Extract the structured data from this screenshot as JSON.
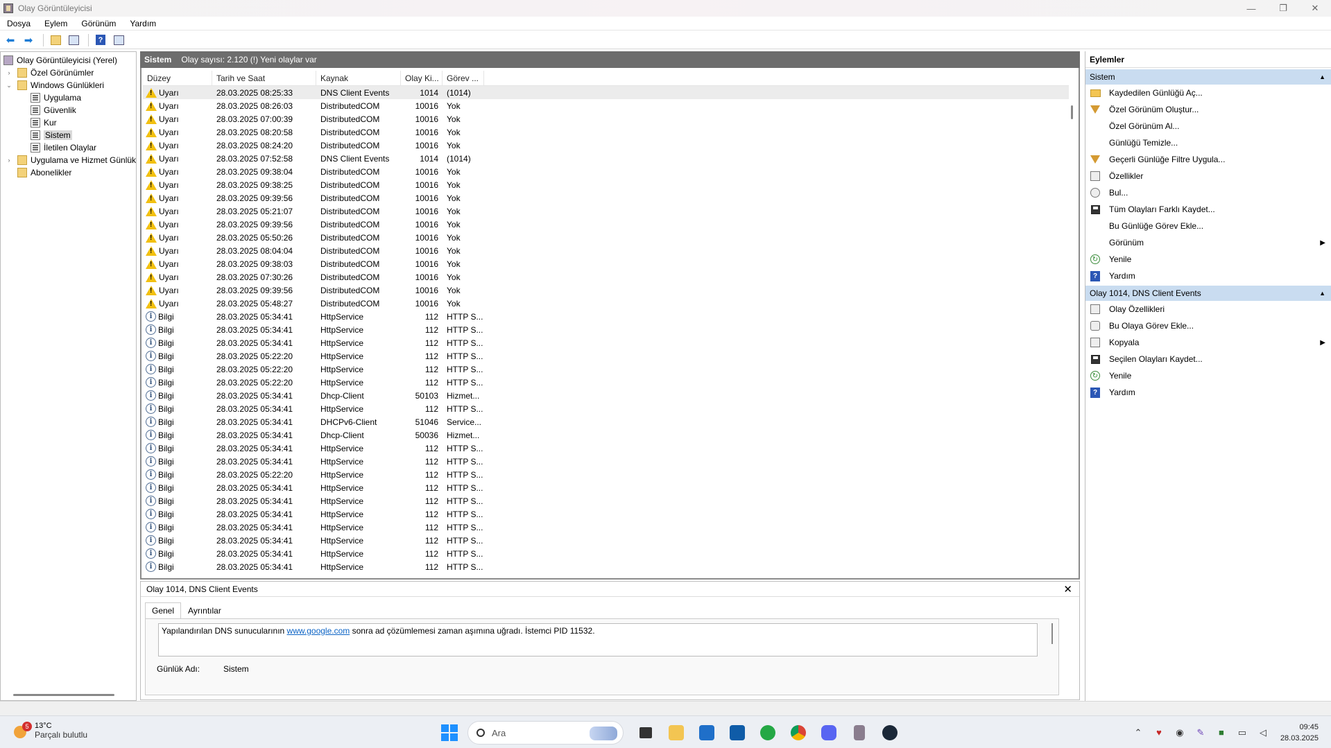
{
  "window": {
    "title": "Olay Görüntüleyicisi",
    "controls": [
      "—",
      "❐",
      "✕"
    ]
  },
  "menu": [
    "Dosya",
    "Eylem",
    "Görünüm",
    "Yardım"
  ],
  "tree": [
    {
      "label": "Olay Görüntüleyicisi (Yerel)",
      "level": 0,
      "expander": "",
      "icon": "event-viewer-icon"
    },
    {
      "label": "Özel Görünümler",
      "level": 1,
      "expander": "›",
      "icon": "folder-icon"
    },
    {
      "label": "Windows Günlükleri",
      "level": 1,
      "expander": "⌄",
      "icon": "folder-icon"
    },
    {
      "label": "Uygulama",
      "level": 2,
      "expander": "",
      "icon": "log-icon"
    },
    {
      "label": "Güvenlik",
      "level": 2,
      "expander": "",
      "icon": "log-icon"
    },
    {
      "label": "Kur",
      "level": 2,
      "expander": "",
      "icon": "log-icon"
    },
    {
      "label": "Sistem",
      "level": 2,
      "expander": "",
      "icon": "log-icon",
      "selected": true
    },
    {
      "label": "İletilen Olaylar",
      "level": 2,
      "expander": "",
      "icon": "log-icon"
    },
    {
      "label": "Uygulama ve Hizmet Günlük",
      "level": 1,
      "expander": "›",
      "icon": "folder-icon"
    },
    {
      "label": "Abonelikler",
      "level": 1,
      "expander": "",
      "icon": "subscriptions-icon"
    }
  ],
  "center": {
    "log_name": "Sistem",
    "event_count_text": "Olay sayısı: 2.120 (!) Yeni olaylar var",
    "columns": [
      "Düzey",
      "Tarih ve Saat",
      "Kaynak",
      "Olay Ki...",
      "Görev ..."
    ],
    "rows": [
      {
        "level": "Uyarı",
        "type": "warning",
        "date": "28.03.2025 08:25:33",
        "source": "DNS Client Events",
        "id": "1014",
        "task": "(1014)"
      },
      {
        "level": "Uyarı",
        "type": "warning",
        "date": "28.03.2025 08:26:03",
        "source": "DistributedCOM",
        "id": "10016",
        "task": "Yok"
      },
      {
        "level": "Uyarı",
        "type": "warning",
        "date": "28.03.2025 07:00:39",
        "source": "DistributedCOM",
        "id": "10016",
        "task": "Yok"
      },
      {
        "level": "Uyarı",
        "type": "warning",
        "date": "28.03.2025 08:20:58",
        "source": "DistributedCOM",
        "id": "10016",
        "task": "Yok"
      },
      {
        "level": "Uyarı",
        "type": "warning",
        "date": "28.03.2025 08:24:20",
        "source": "DistributedCOM",
        "id": "10016",
        "task": "Yok"
      },
      {
        "level": "Uyarı",
        "type": "warning",
        "date": "28.03.2025 07:52:58",
        "source": "DNS Client Events",
        "id": "1014",
        "task": "(1014)"
      },
      {
        "level": "Uyarı",
        "type": "warning",
        "date": "28.03.2025 09:38:04",
        "source": "DistributedCOM",
        "id": "10016",
        "task": "Yok"
      },
      {
        "level": "Uyarı",
        "type": "warning",
        "date": "28.03.2025 09:38:25",
        "source": "DistributedCOM",
        "id": "10016",
        "task": "Yok"
      },
      {
        "level": "Uyarı",
        "type": "warning",
        "date": "28.03.2025 09:39:56",
        "source": "DistributedCOM",
        "id": "10016",
        "task": "Yok"
      },
      {
        "level": "Uyarı",
        "type": "warning",
        "date": "28.03.2025 05:21:07",
        "source": "DistributedCOM",
        "id": "10016",
        "task": "Yok"
      },
      {
        "level": "Uyarı",
        "type": "warning",
        "date": "28.03.2025 09:39:56",
        "source": "DistributedCOM",
        "id": "10016",
        "task": "Yok"
      },
      {
        "level": "Uyarı",
        "type": "warning",
        "date": "28.03.2025 05:50:26",
        "source": "DistributedCOM",
        "id": "10016",
        "task": "Yok"
      },
      {
        "level": "Uyarı",
        "type": "warning",
        "date": "28.03.2025 08:04:04",
        "source": "DistributedCOM",
        "id": "10016",
        "task": "Yok"
      },
      {
        "level": "Uyarı",
        "type": "warning",
        "date": "28.03.2025 09:38:03",
        "source": "DistributedCOM",
        "id": "10016",
        "task": "Yok"
      },
      {
        "level": "Uyarı",
        "type": "warning",
        "date": "28.03.2025 07:30:26",
        "source": "DistributedCOM",
        "id": "10016",
        "task": "Yok"
      },
      {
        "level": "Uyarı",
        "type": "warning",
        "date": "28.03.2025 09:39:56",
        "source": "DistributedCOM",
        "id": "10016",
        "task": "Yok"
      },
      {
        "level": "Uyarı",
        "type": "warning",
        "date": "28.03.2025 05:48:27",
        "source": "DistributedCOM",
        "id": "10016",
        "task": "Yok"
      },
      {
        "level": "Bilgi",
        "type": "info",
        "date": "28.03.2025 05:34:41",
        "source": "HttpService",
        "id": "112",
        "task": "HTTP S..."
      },
      {
        "level": "Bilgi",
        "type": "info",
        "date": "28.03.2025 05:34:41",
        "source": "HttpService",
        "id": "112",
        "task": "HTTP S..."
      },
      {
        "level": "Bilgi",
        "type": "info",
        "date": "28.03.2025 05:34:41",
        "source": "HttpService",
        "id": "112",
        "task": "HTTP S..."
      },
      {
        "level": "Bilgi",
        "type": "info",
        "date": "28.03.2025 05:22:20",
        "source": "HttpService",
        "id": "112",
        "task": "HTTP S..."
      },
      {
        "level": "Bilgi",
        "type": "info",
        "date": "28.03.2025 05:22:20",
        "source": "HttpService",
        "id": "112",
        "task": "HTTP S..."
      },
      {
        "level": "Bilgi",
        "type": "info",
        "date": "28.03.2025 05:22:20",
        "source": "HttpService",
        "id": "112",
        "task": "HTTP S..."
      },
      {
        "level": "Bilgi",
        "type": "info",
        "date": "28.03.2025 05:34:41",
        "source": "Dhcp-Client",
        "id": "50103",
        "task": "Hizmet..."
      },
      {
        "level": "Bilgi",
        "type": "info",
        "date": "28.03.2025 05:34:41",
        "source": "HttpService",
        "id": "112",
        "task": "HTTP S..."
      },
      {
        "level": "Bilgi",
        "type": "info",
        "date": "28.03.2025 05:34:41",
        "source": "DHCPv6-Client",
        "id": "51046",
        "task": "Service..."
      },
      {
        "level": "Bilgi",
        "type": "info",
        "date": "28.03.2025 05:34:41",
        "source": "Dhcp-Client",
        "id": "50036",
        "task": "Hizmet..."
      },
      {
        "level": "Bilgi",
        "type": "info",
        "date": "28.03.2025 05:34:41",
        "source": "HttpService",
        "id": "112",
        "task": "HTTP S..."
      },
      {
        "level": "Bilgi",
        "type": "info",
        "date": "28.03.2025 05:34:41",
        "source": "HttpService",
        "id": "112",
        "task": "HTTP S..."
      },
      {
        "level": "Bilgi",
        "type": "info",
        "date": "28.03.2025 05:22:20",
        "source": "HttpService",
        "id": "112",
        "task": "HTTP S..."
      },
      {
        "level": "Bilgi",
        "type": "info",
        "date": "28.03.2025 05:34:41",
        "source": "HttpService",
        "id": "112",
        "task": "HTTP S..."
      },
      {
        "level": "Bilgi",
        "type": "info",
        "date": "28.03.2025 05:34:41",
        "source": "HttpService",
        "id": "112",
        "task": "HTTP S..."
      },
      {
        "level": "Bilgi",
        "type": "info",
        "date": "28.03.2025 05:34:41",
        "source": "HttpService",
        "id": "112",
        "task": "HTTP S..."
      },
      {
        "level": "Bilgi",
        "type": "info",
        "date": "28.03.2025 05:34:41",
        "source": "HttpService",
        "id": "112",
        "task": "HTTP S..."
      },
      {
        "level": "Bilgi",
        "type": "info",
        "date": "28.03.2025 05:34:41",
        "source": "HttpService",
        "id": "112",
        "task": "HTTP S..."
      },
      {
        "level": "Bilgi",
        "type": "info",
        "date": "28.03.2025 05:34:41",
        "source": "HttpService",
        "id": "112",
        "task": "HTTP S..."
      },
      {
        "level": "Bilgi",
        "type": "info",
        "date": "28.03.2025 05:34:41",
        "source": "HttpService",
        "id": "112",
        "task": "HTTP S..."
      }
    ]
  },
  "detail": {
    "title": "Olay 1014, DNS Client Events",
    "close": "✕",
    "tabs": [
      "Genel",
      "Ayrıntılar"
    ],
    "message_before": "Yapılandırılan DNS sunucularının ",
    "message_link": "www.google.com",
    "message_after": " sonra ad çözümlemesi zaman aşımına uğradı. İstemci PID 11532.",
    "log_name_label": "Günlük Adı:",
    "log_name_value": "Sistem"
  },
  "actions": {
    "title": "Eylemler",
    "sections": [
      {
        "name": "Sistem",
        "items": [
          {
            "label": "Kaydedilen Günlüğü Aç...",
            "icon": "open-log-icon"
          },
          {
            "label": "Özel Görünüm Oluştur...",
            "icon": "filter-icon"
          },
          {
            "label": "Özel Görünüm Al...",
            "icon": ""
          },
          {
            "label": "Günlüğü Temizle...",
            "icon": ""
          },
          {
            "label": "Geçerli Günlüğe Filtre Uygula...",
            "icon": "filter-icon"
          },
          {
            "label": "Özellikler",
            "icon": "properties-icon"
          },
          {
            "label": "Bul...",
            "icon": "find-icon"
          },
          {
            "label": "Tüm Olayları Farklı Kaydet...",
            "icon": "save-icon"
          },
          {
            "label": "Bu Günlüğe Görev Ekle...",
            "icon": ""
          },
          {
            "label": "Görünüm",
            "icon": "",
            "submenu": true
          },
          {
            "label": "Yenile",
            "icon": "refresh-icon"
          },
          {
            "label": "Yardım",
            "icon": "help-icon"
          }
        ]
      },
      {
        "name": "Olay 1014, DNS Client Events",
        "items": [
          {
            "label": "Olay Özellikleri",
            "icon": "properties-icon"
          },
          {
            "label": "Bu Olaya Görev Ekle...",
            "icon": "task-icon"
          },
          {
            "label": "Kopyala",
            "icon": "copy-icon",
            "submenu": true
          },
          {
            "label": "Seçilen Olayları Kaydet...",
            "icon": "save-icon"
          },
          {
            "label": "Yenile",
            "icon": "refresh-icon"
          },
          {
            "label": "Yardım",
            "icon": "help-icon"
          }
        ]
      }
    ]
  },
  "taskbar": {
    "weather_temp": "13°C",
    "weather_desc": "Parçalı bulutlu",
    "weather_badge": "5",
    "search_placeholder": "Ara",
    "time": "09:45",
    "date": "28.03.2025"
  }
}
